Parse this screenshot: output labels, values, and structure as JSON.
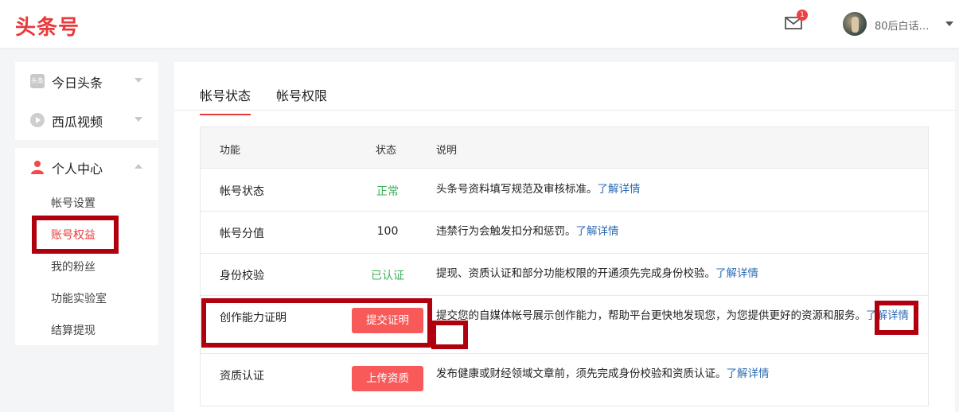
{
  "header": {
    "logo": "头条号",
    "mail_badge": "1",
    "username": "80后白话…"
  },
  "sidebar": {
    "platforms": [
      {
        "label": "今日头条",
        "icon": "toutiao-icon",
        "icon_text": "头条"
      },
      {
        "label": "西瓜视频",
        "icon": "xigua-video-icon"
      }
    ],
    "personal": {
      "label": "个人中心",
      "icon": "user-icon",
      "items": [
        {
          "label": "帐号设置"
        },
        {
          "label": "账号权益"
        },
        {
          "label": "我的粉丝"
        },
        {
          "label": "功能实验室"
        },
        {
          "label": "结算提现"
        }
      ]
    }
  },
  "tabs": [
    {
      "label": "帐号状态"
    },
    {
      "label": "帐号权限"
    }
  ],
  "table": {
    "headers": {
      "func": "功能",
      "status": "状态",
      "desc": "说明"
    },
    "rows": [
      {
        "func": "帐号状态",
        "status": "正常",
        "desc": "头条号资料填写规范及审核标准。",
        "link": "了解详情"
      },
      {
        "func": "帐号分值",
        "status": "100",
        "desc": "违禁行为会触发扣分和惩罚。",
        "link": "了解详情"
      },
      {
        "func": "身份校验",
        "status": "已认证",
        "desc": "提现、资质认证和部分功能权限的开通须先完成身份校验。",
        "link": "了解详情"
      },
      {
        "func": "创作能力证明",
        "button": "提交证明",
        "desc": "提交您的自媒体帐号展示创作能力，帮助平台更快地发现您，为您提供更好的资源和服务。",
        "link": "了解详情"
      },
      {
        "func": "资质认证",
        "button": "上传资质",
        "desc": "发布健康或财经领域文章前，须先完成身份校验和资质认证。",
        "link": "了解详情"
      }
    ]
  },
  "colors": {
    "accent": "#e8393c",
    "status_green": "#3cb15a",
    "link_blue": "#2d6bb3",
    "button_red": "#f85959",
    "highlight": "#b0000e"
  }
}
